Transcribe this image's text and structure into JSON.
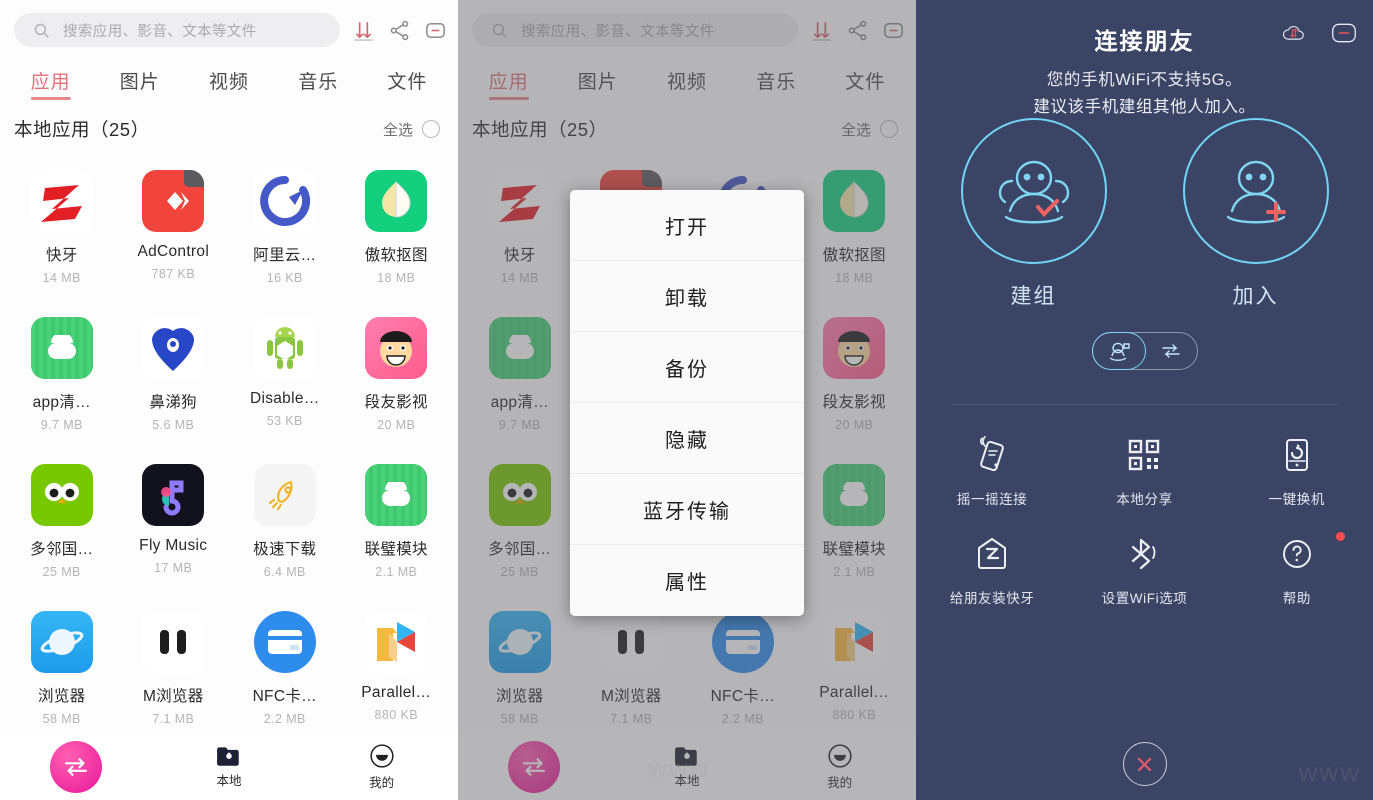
{
  "search": {
    "placeholder": "搜索应用、影音、文本等文件",
    "icon": "search-icon"
  },
  "header_icons": [
    {
      "name": "transfer-sort-icon",
      "label": "传输"
    },
    {
      "name": "share-icon",
      "label": "分享"
    },
    {
      "name": "window-minimize-icon",
      "label": "最小化"
    }
  ],
  "tabs": [
    {
      "label": "应用",
      "active": true
    },
    {
      "label": "图片",
      "active": false
    },
    {
      "label": "视频",
      "active": false
    },
    {
      "label": "音乐",
      "active": false
    },
    {
      "label": "文件",
      "active": false
    }
  ],
  "section": {
    "title": "本地应用（25）",
    "select_all": "全选",
    "count": 25
  },
  "apps": [
    {
      "name": "快牙",
      "size": "14 MB",
      "icon": "zapya-icon"
    },
    {
      "name": "AdControl",
      "size": "787 KB",
      "icon": "adcontrol-icon"
    },
    {
      "name": "阿里云…",
      "size": "16 KB",
      "icon": "aliyun-icon"
    },
    {
      "name": "傲软抠图",
      "size": "18 MB",
      "icon": "apowersoft-cutout-icon"
    },
    {
      "name": "app清…",
      "size": "9.7 MB",
      "icon": "app-cleaner-icon"
    },
    {
      "name": "鼻涕狗",
      "size": "5.6 MB",
      "icon": "bitigou-icon"
    },
    {
      "name": "Disable…",
      "size": "53 KB",
      "icon": "disable-android-icon"
    },
    {
      "name": "段友影视",
      "size": "20 MB",
      "icon": "duanyou-video-icon"
    },
    {
      "name": "多邻国…",
      "size": "25 MB",
      "icon": "duolingo-icon"
    },
    {
      "name": "Fly Music",
      "size": "17 MB",
      "icon": "fly-music-icon"
    },
    {
      "name": "极速下载",
      "size": "6.4 MB",
      "icon": "fast-download-icon"
    },
    {
      "name": "联璧模块",
      "size": "2.1 MB",
      "icon": "lianbi-module-icon"
    },
    {
      "name": "浏览器",
      "size": "58 MB",
      "icon": "browser-icon"
    },
    {
      "name": "M浏览器",
      "size": "7.1 MB",
      "icon": "m-browser-icon"
    },
    {
      "name": "NFC卡…",
      "size": "2.2 MB",
      "icon": "nfc-card-icon"
    },
    {
      "name": "Parallel…",
      "size": "880 KB",
      "icon": "parallel-space-icon"
    }
  ],
  "bottom_nav": [
    {
      "label": "",
      "icon": "transfer-arrows-icon",
      "active": false
    },
    {
      "label": "本地",
      "icon": "folder-icon",
      "active": true
    },
    {
      "label": "我的",
      "icon": "profile-smile-icon",
      "active": false
    }
  ],
  "context_menu": {
    "items": [
      "打开",
      "卸载",
      "备份",
      "隐藏",
      "蓝牙传输",
      "属性"
    ]
  },
  "connect": {
    "title": "连接朋友",
    "subtitle_line1": "您的手机WiFi不支持5G。",
    "subtitle_line2": "建议该手机建组其他人加入。",
    "header_icons": [
      {
        "name": "cloud-transfer-icon"
      },
      {
        "name": "window-minimize-icon"
      }
    ],
    "primary_actions": [
      {
        "label": "建组",
        "icon": "create-group-icon"
      },
      {
        "label": "加入",
        "icon": "join-group-icon"
      }
    ],
    "mode_toggle": [
      {
        "name": "radar-people-icon",
        "selected": true
      },
      {
        "name": "swap-arrows-icon",
        "selected": false
      }
    ],
    "actions": [
      {
        "label": "摇一摇连接",
        "icon": "shake-connect-icon",
        "badge": false
      },
      {
        "label": "本地分享",
        "icon": "qr-code-icon",
        "badge": false
      },
      {
        "label": "一键换机",
        "icon": "phone-switch-icon",
        "badge": false
      },
      {
        "label": "给朋友装快牙",
        "icon": "install-zapya-icon",
        "badge": false
      },
      {
        "label": "设置WiFi选项",
        "icon": "bluetooth-icon",
        "badge": false
      },
      {
        "label": "帮助",
        "icon": "help-question-icon",
        "badge": true
      }
    ],
    "close": {
      "name": "close-icon"
    }
  },
  "colors": {
    "accent_red": "#e2727a",
    "dark_bg": "#3c4465",
    "cyan": "#6fd4f5",
    "pink": "#e8189c",
    "badge_red": "#ff4d4d"
  },
  "watermark": "www"
}
